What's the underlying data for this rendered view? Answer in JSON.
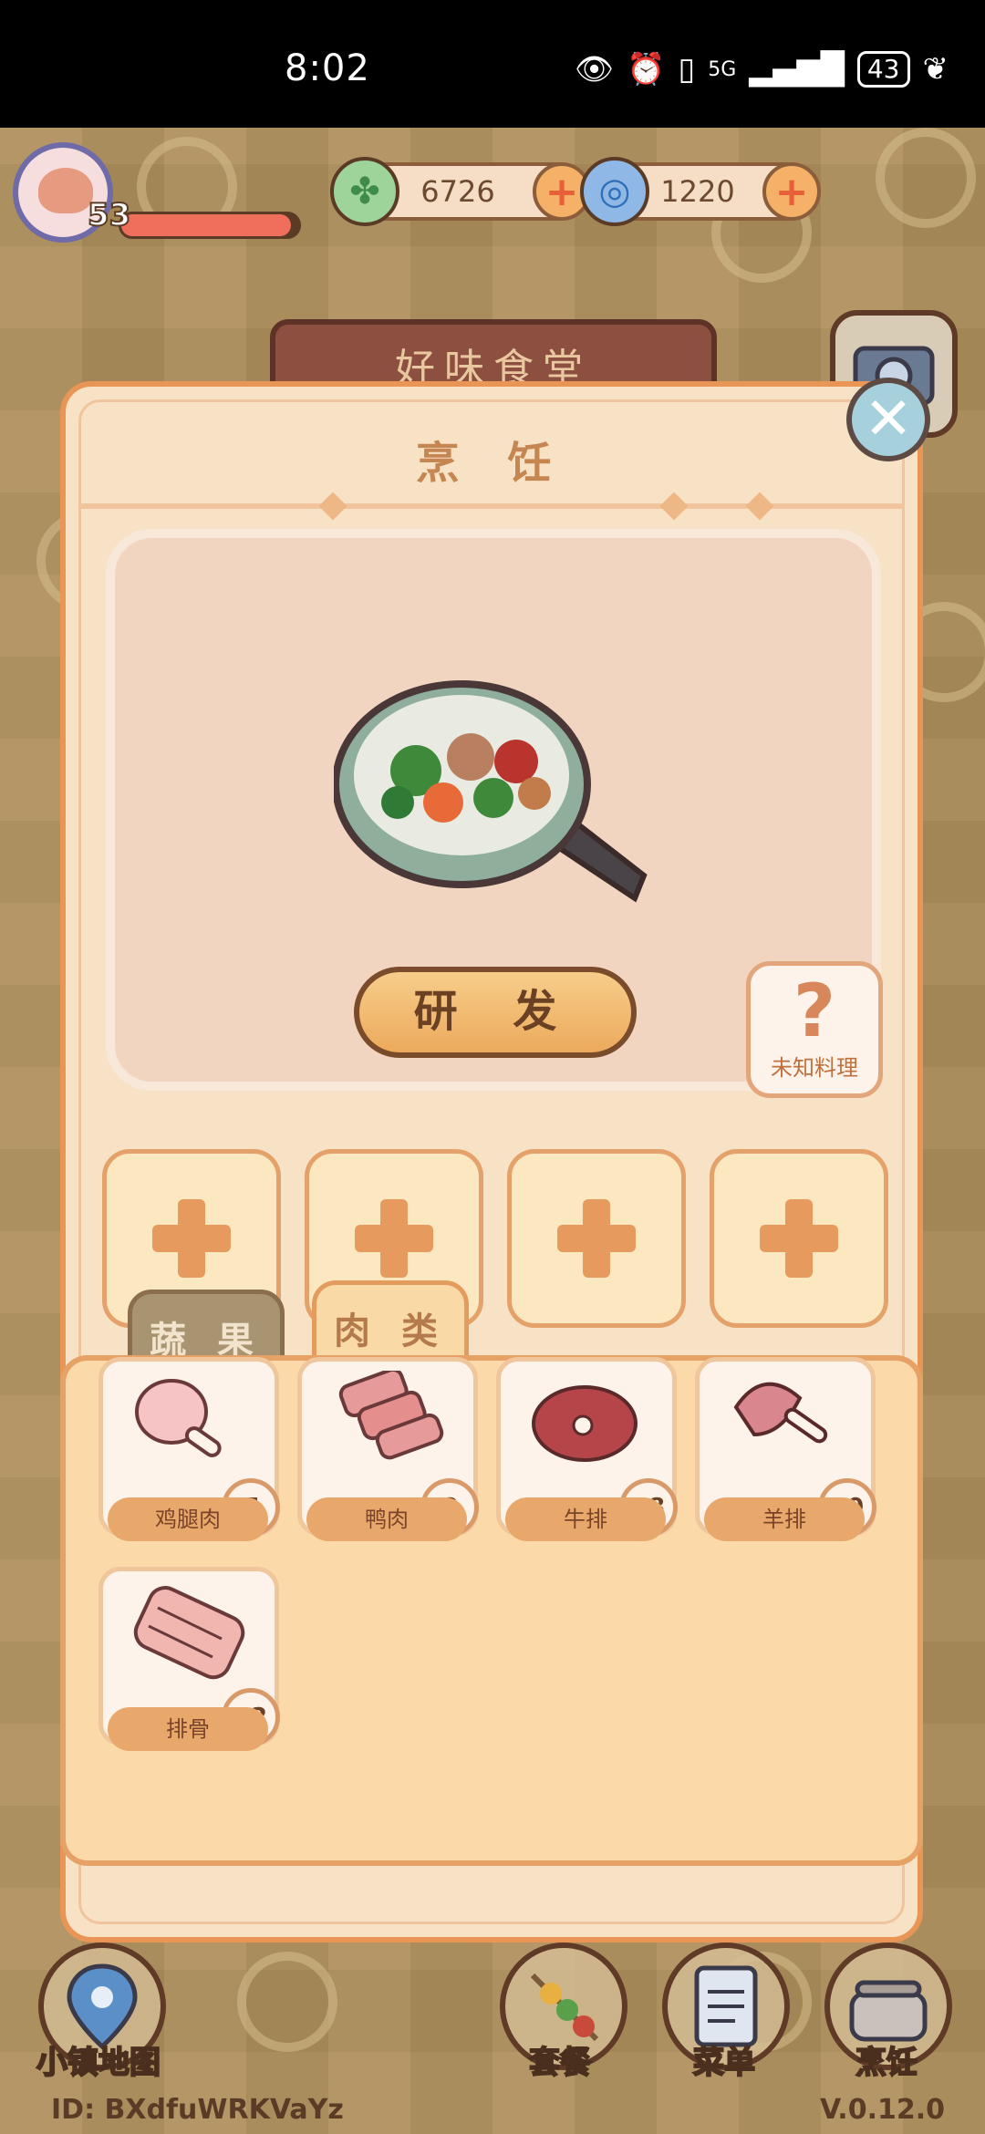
{
  "status_bar": {
    "time": "8:02",
    "network": "5G",
    "battery": "43"
  },
  "hud": {
    "level": "53",
    "xp_fraction": 0.96,
    "currencies": [
      {
        "icon": "clover-icon",
        "value": "6726"
      },
      {
        "icon": "spiral-gem-icon",
        "value": "1220"
      }
    ],
    "plus_label": "+"
  },
  "background": {
    "sign_text": "好味食堂"
  },
  "dialog": {
    "title": "烹 饪",
    "close_label": "✕",
    "research_button": "研 发",
    "unknown_dish": {
      "symbol": "?",
      "label": "未知料理"
    },
    "empty_slots": [
      "+",
      "+",
      "+",
      "+"
    ],
    "tabs": [
      {
        "label": "蔬 果",
        "active": false
      },
      {
        "label": "肉 类",
        "active": true
      }
    ],
    "ingredients": [
      {
        "name": "鸡腿肉",
        "count": "7",
        "icon": "drumstick-icon"
      },
      {
        "name": "鸭肉",
        "count": "8",
        "icon": "bacon-icon"
      },
      {
        "name": "牛排",
        "count": "18",
        "icon": "steak-icon"
      },
      {
        "name": "羊排",
        "count": "10",
        "icon": "lamb-chop-icon"
      },
      {
        "name": "排骨",
        "count": "12",
        "icon": "ribs-icon"
      }
    ]
  },
  "bottom_nav": [
    {
      "label": "小镇地图",
      "icon": "map-pin-icon"
    },
    {
      "label": "套餐",
      "icon": "skewer-icon"
    },
    {
      "label": "菜单",
      "icon": "clipboard-icon"
    },
    {
      "label": "烹饪",
      "icon": "pot-icon"
    }
  ],
  "footer": {
    "id": "ID:  BXdfuWRKVaYz",
    "version": "V.0.12.0"
  }
}
